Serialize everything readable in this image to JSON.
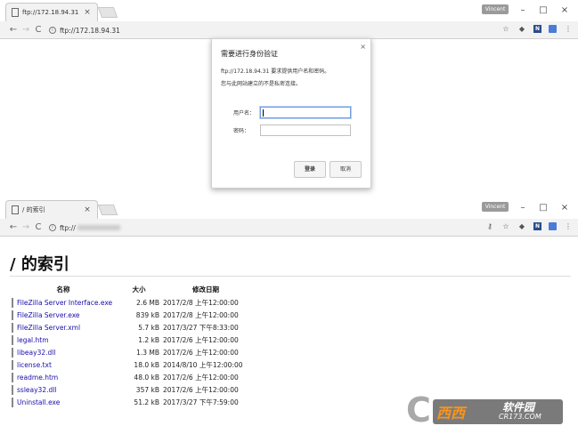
{
  "window1": {
    "tab_title": "ftp://172.18.94.31",
    "tab_close": "×",
    "profile": "Vincent",
    "controls": {
      "minimize": "–",
      "maximize": "□",
      "close": "×"
    },
    "url": "ftp://172.18.94.31"
  },
  "auth_dialog": {
    "close": "×",
    "title": "需要进行身份验证",
    "message": "ftp://172.18.94.31 要求提供用户名和密码。",
    "warning": "您与此网站建立的不是私密连接。",
    "username_label": "用户名：",
    "password_label": "密码：",
    "login_button": "登录",
    "cancel_button": "取消"
  },
  "window2": {
    "tab_title": "/ 的索引",
    "tab_close": "×",
    "profile": "Vincent",
    "controls": {
      "minimize": "–",
      "maximize": "□",
      "close": "×"
    },
    "url_prefix": "ftp://"
  },
  "listing": {
    "title": "/ 的索引",
    "headers": {
      "name": "名称",
      "size": "大小",
      "date": "修改日期"
    },
    "rows": [
      {
        "name": "FileZilla Server Interface.exe",
        "size": "2.6 MB",
        "date": "2017/2/8 上午12:00:00"
      },
      {
        "name": "FileZilla Server.exe",
        "size": "839 kB",
        "date": "2017/2/8 上午12:00:00"
      },
      {
        "name": "FileZilla Server.xml",
        "size": "5.7 kB",
        "date": "2017/3/27 下午8:33:00"
      },
      {
        "name": "legal.htm",
        "size": "1.2 kB",
        "date": "2017/2/6 上午12:00:00"
      },
      {
        "name": "libeay32.dll",
        "size": "1.3 MB",
        "date": "2017/2/6 上午12:00:00"
      },
      {
        "name": "license.txt",
        "size": "18.0 kB",
        "date": "2014/8/10 上午12:00:00"
      },
      {
        "name": "readme.htm",
        "size": "48.0 kB",
        "date": "2017/2/6 上午12:00:00"
      },
      {
        "name": "ssleay32.dll",
        "size": "357 kB",
        "date": "2017/2/6 上午12:00:00"
      },
      {
        "name": "Uninstall.exe",
        "size": "51.2 kB",
        "date": "2017/3/27 下午7:59:00"
      }
    ]
  },
  "watermark": {
    "brand": "西西",
    "slogan": "软件园",
    "url": "CR173.COM"
  },
  "colors": {
    "link": "#1a0dab",
    "toolbar": "#f2f2f2"
  }
}
